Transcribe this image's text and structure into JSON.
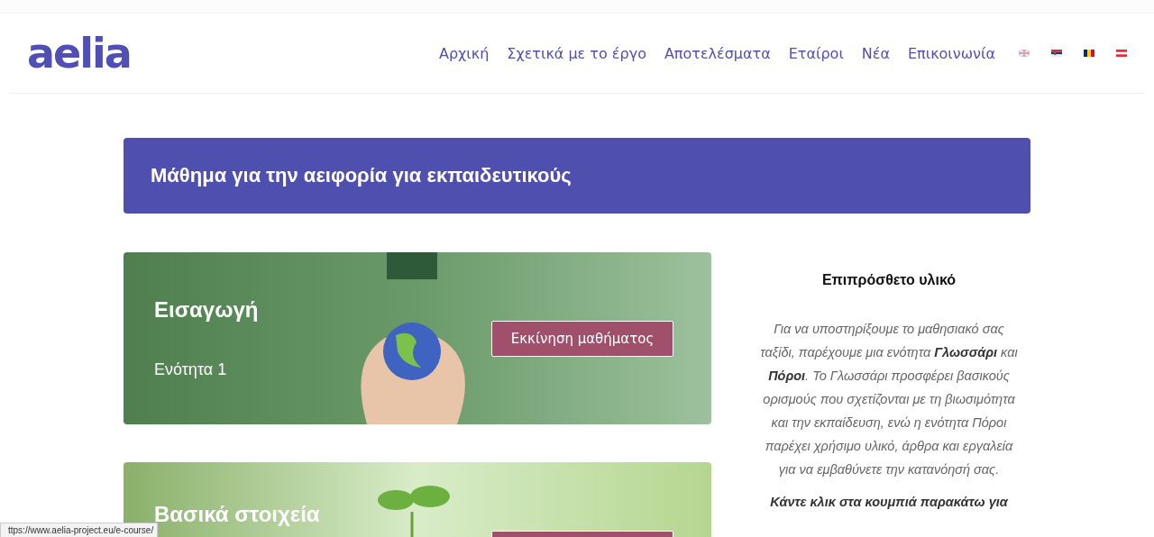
{
  "header": {
    "logo": "aelia",
    "nav": [
      {
        "label": "Αρχική"
      },
      {
        "label": "Σχετικά με το έργο"
      },
      {
        "label": "Αποτελέσματα"
      },
      {
        "label": "Εταίροι"
      },
      {
        "label": "Νέα"
      },
      {
        "label": "Επικοινωνία"
      }
    ]
  },
  "banner": {
    "title": "Μάθημα για την αειφορία για εκπαιδευτικούς"
  },
  "courses": [
    {
      "kind": "globe",
      "title": "Εισαγωγή",
      "subtitle": "Ενότητα 1",
      "button": "Εκκίνηση μαθήματος"
    },
    {
      "kind": "sprout",
      "title": "Βασικά στοιχεία"
    }
  ],
  "sidebar": {
    "title": "Επιπρόσθετο υλικό",
    "text": "Για να υποστηρίξουμε το μαθησιακό σας ταξίδι, παρέχουμε μια ενότητα **Γλωσσάρι** και **Πόροι**. Το Γλωσσάρι προσφέρει βασικούς ορισμούς που σχετίζονται με τη βιωσιμότητα και την εκπαίδευση, ενώ η ενότητα Πόροι παρέχει χρήσιμο υλικό, άρθρα και εργαλεία για να εμβαθύνετε την κατανόησή σας.",
    "call_to_action": "Κάντε κλικ στα κουμπιά παρακάτω για"
  },
  "status_bar": {
    "url": "ttps://www.aelia-project.eu/e-course/"
  }
}
